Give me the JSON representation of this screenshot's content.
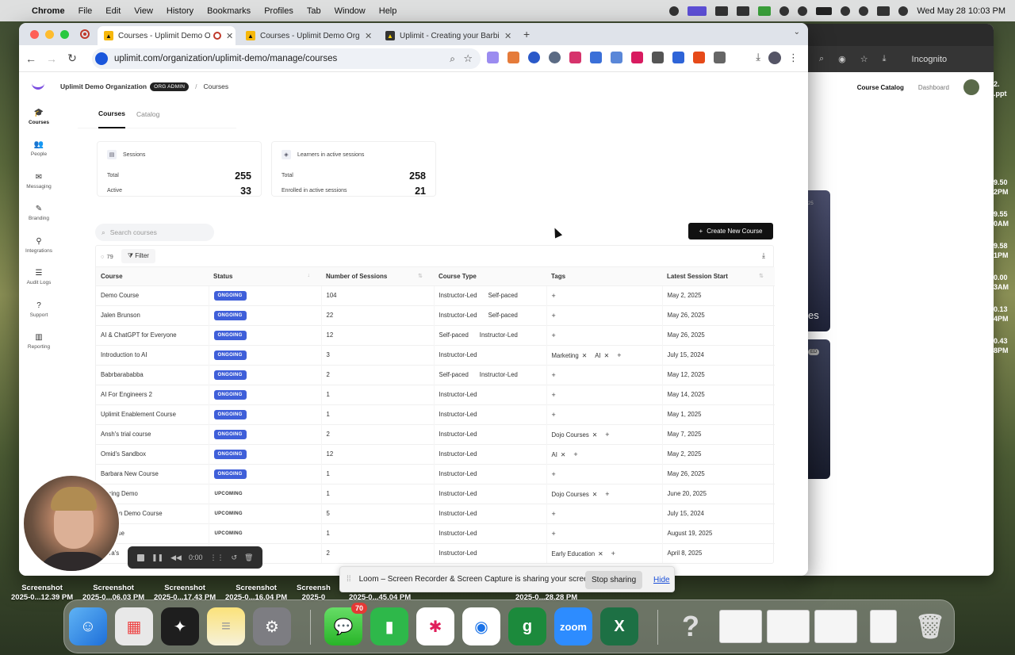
{
  "menubar": {
    "app": "Chrome",
    "items": [
      "File",
      "Edit",
      "View",
      "History",
      "Bookmarks",
      "Profiles",
      "Tab",
      "Window",
      "Help"
    ],
    "clock": "Wed May 28  10:03 PM"
  },
  "browser": {
    "tabs": [
      {
        "title": "Courses - Uplimit Demo O",
        "active": true
      },
      {
        "title": "Courses - Uplimit Demo Orga",
        "active": false
      },
      {
        "title": "Uplimit - Creating your Barbie",
        "active": false
      }
    ],
    "url": "uplimit.com/organization/uplimit-demo/manage/courses"
  },
  "bg_window": {
    "incognito": "Incognito",
    "nav_active": "Course Catalog",
    "nav_other": "Dashboard",
    "card1_pill": "25",
    "card1_text": "es",
    "card2_pill": "ED"
  },
  "right_strip": [
    "2.",
    ".ppt",
    "9.50",
    "2PM",
    "9.55",
    "0AM",
    "9.58",
    "1PM",
    "0.00",
    "3AM",
    "0.13",
    "4PM",
    "0.43",
    "8PM"
  ],
  "app": {
    "org": "Uplimit Demo Organization",
    "org_badge": "ORG ADMIN",
    "breadcrumb": "Courses",
    "sidebar": [
      "Courses",
      "People",
      "Messaging",
      "Branding",
      "Integrations",
      "Audit Logs",
      "Support",
      "Reporting"
    ],
    "subtabs": [
      "Courses",
      "Catalog"
    ],
    "stats": [
      {
        "title": "Sessions",
        "rows": [
          {
            "label": "Total",
            "value": "255"
          },
          {
            "label": "Active",
            "value": "33"
          }
        ]
      },
      {
        "title": "Learners in active sessions",
        "rows": [
          {
            "label": "Total",
            "value": "258"
          },
          {
            "label": "Enrolled in active sessions",
            "value": "21"
          }
        ]
      }
    ],
    "search_placeholder": "Search courses",
    "create_button": "Create New Course",
    "table": {
      "count": "79",
      "filter": "Filter",
      "columns": [
        "Course",
        "Status",
        "Number of Sessions",
        "Course Type",
        "Tags",
        "Latest Session Start"
      ],
      "rows": [
        {
          "course": "Demo Course",
          "status": "ONGOING",
          "sessions": "104",
          "types": [
            "Instructor-Led",
            "Self-paced"
          ],
          "tags": [],
          "start": "May 2, 2025"
        },
        {
          "course": "Jalen Brunson",
          "status": "ONGOING",
          "sessions": "22",
          "types": [
            "Instructor-Led",
            "Self-paced"
          ],
          "tags": [],
          "start": "May 26, 2025"
        },
        {
          "course": "AI & ChatGPT for Everyone",
          "status": "ONGOING",
          "sessions": "12",
          "types": [
            "Self-paced",
            "Instructor-Led"
          ],
          "tags": [],
          "start": "May 26, 2025"
        },
        {
          "course": "Introduction to AI",
          "status": "ONGOING",
          "sessions": "3",
          "types": [
            "Instructor-Led"
          ],
          "tags": [
            "Marketing",
            "AI"
          ],
          "start": "July 15, 2024"
        },
        {
          "course": "Babrbarababba",
          "status": "ONGOING",
          "sessions": "2",
          "types": [
            "Self-paced",
            "Instructor-Led"
          ],
          "tags": [],
          "start": "May 12, 2025"
        },
        {
          "course": "AI For Engineers 2",
          "status": "ONGOING",
          "sessions": "1",
          "types": [
            "Instructor-Led"
          ],
          "tags": [],
          "start": "May 14, 2025"
        },
        {
          "course": "Uplimit Enablement Course",
          "status": "ONGOING",
          "sessions": "1",
          "types": [
            "Instructor-Led"
          ],
          "tags": [],
          "start": "May 1, 2025"
        },
        {
          "course": "Ansh's trial course",
          "status": "ONGOING",
          "sessions": "2",
          "types": [
            "Instructor-Led"
          ],
          "tags": [
            "Dojo Courses"
          ],
          "start": "May 7, 2025"
        },
        {
          "course": "Omid's Sandbox",
          "status": "ONGOING",
          "sessions": "12",
          "types": [
            "Instructor-Led"
          ],
          "tags": [
            "AI"
          ],
          "start": "May 2, 2025"
        },
        {
          "course": "Barbara New Course",
          "status": "ONGOING",
          "sessions": "1",
          "types": [
            "Instructor-Led"
          ],
          "tags": [],
          "start": "May 26, 2025"
        },
        {
          "course": "...oring Demo",
          "status": "UPCOMING",
          "sessions": "1",
          "types": [
            "Instructor-Led"
          ],
          "tags": [
            "Dojo Courses"
          ],
          "start": "June 20, 2025"
        },
        {
          "course": "...cation Demo Course",
          "status": "UPCOMING",
          "sessions": "5",
          "types": [
            "Instructor-Led"
          ],
          "tags": [],
          "start": "July 15, 2024"
        },
        {
          "course": "...course",
          "status": "UPCOMING",
          "sessions": "1",
          "types": [
            "Instructor-Led"
          ],
          "tags": [],
          "start": "August 19, 2025"
        },
        {
          "course": "...ara's",
          "status": "",
          "sessions": "2",
          "types": [
            "Instructor-Led"
          ],
          "tags": [
            "Early Education"
          ],
          "start": "April 8, 2025"
        }
      ]
    }
  },
  "loom": {
    "timer": "0:00",
    "share_text": "Loom – Screen Recorder & Screen Capture is sharing your screen.",
    "stop": "Stop sharing",
    "hide": "Hide"
  },
  "desktop": [
    {
      "name": "Screenshot",
      "sub": "2025-0...12.39 PM"
    },
    {
      "name": "Screenshot",
      "sub": "2025-0...06.03 PM"
    },
    {
      "name": "Screenshot",
      "sub": "2025-0...17.43 PM"
    },
    {
      "name": "Screenshot",
      "sub": "2025-0...16.04 PM"
    },
    {
      "name": "Screensh",
      "sub": "2025-0"
    },
    {
      "name": "",
      "sub": "2025-0...45.04 PM"
    },
    {
      "name": "",
      "sub": "2025-0...28.28 PM"
    }
  ],
  "dock": {
    "messages_badge": "70",
    "zoom_label": "zoom"
  },
  "colors": {
    "ongoing": "#3f5fd9",
    "accent_logo": "#7b4ee0"
  }
}
